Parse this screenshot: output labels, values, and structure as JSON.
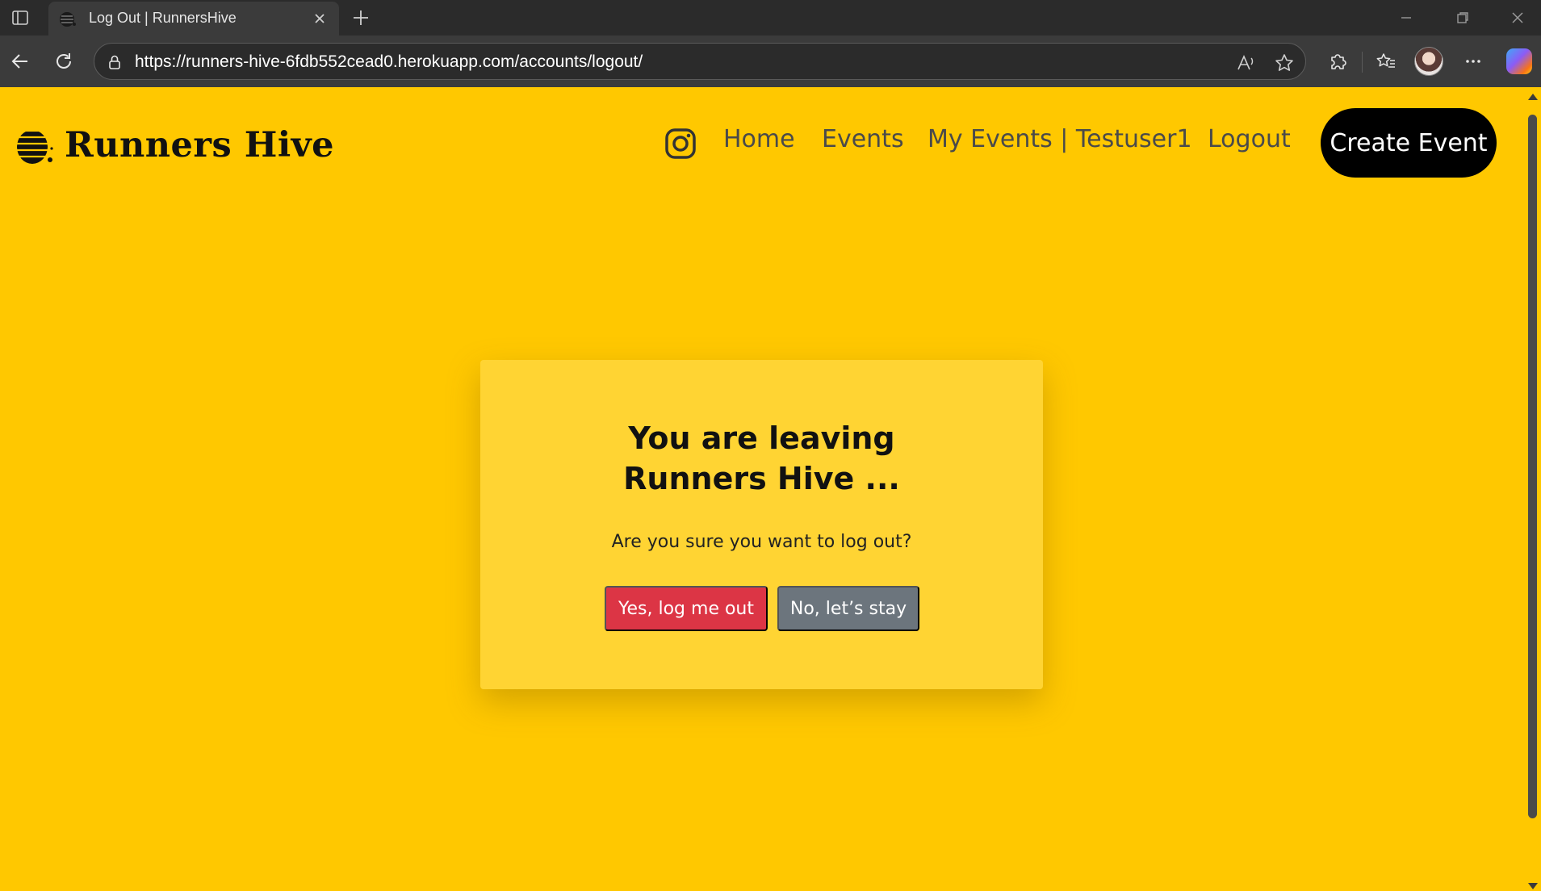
{
  "browser": {
    "tab_title": "Log Out | RunnersHive",
    "url": "https://runners-hive-6fdb552cead0.herokuapp.com/accounts/logout/",
    "icons": {
      "sidebar": "tab-sidebar-icon",
      "close_tab": "close-icon",
      "new_tab": "plus-icon",
      "back": "back-arrow-icon",
      "reload": "reload-icon",
      "site_info": "lock-icon",
      "read_aloud": "read-aloud-icon",
      "favorite": "star-icon",
      "extensions": "puzzle-icon",
      "favorites": "favorites-icon",
      "more": "more-icon",
      "copilot": "copilot-icon"
    }
  },
  "site": {
    "brand_name": "Runners Hive",
    "nav": {
      "home": "Home",
      "events": "Events",
      "my_events": "My Events | Testuser1",
      "logout": "Logout",
      "create_event": "Create Event"
    },
    "colors": {
      "background": "#ffc800",
      "card": "#ffd433",
      "danger": "#dc3545",
      "secondary": "#6c757d",
      "cta": "#000000"
    }
  },
  "logout_card": {
    "title": "You are leaving Runners Hive ...",
    "question": "Are you sure you want to log out?",
    "confirm_label": "Yes, log me out",
    "cancel_label": "No, let’s stay"
  }
}
